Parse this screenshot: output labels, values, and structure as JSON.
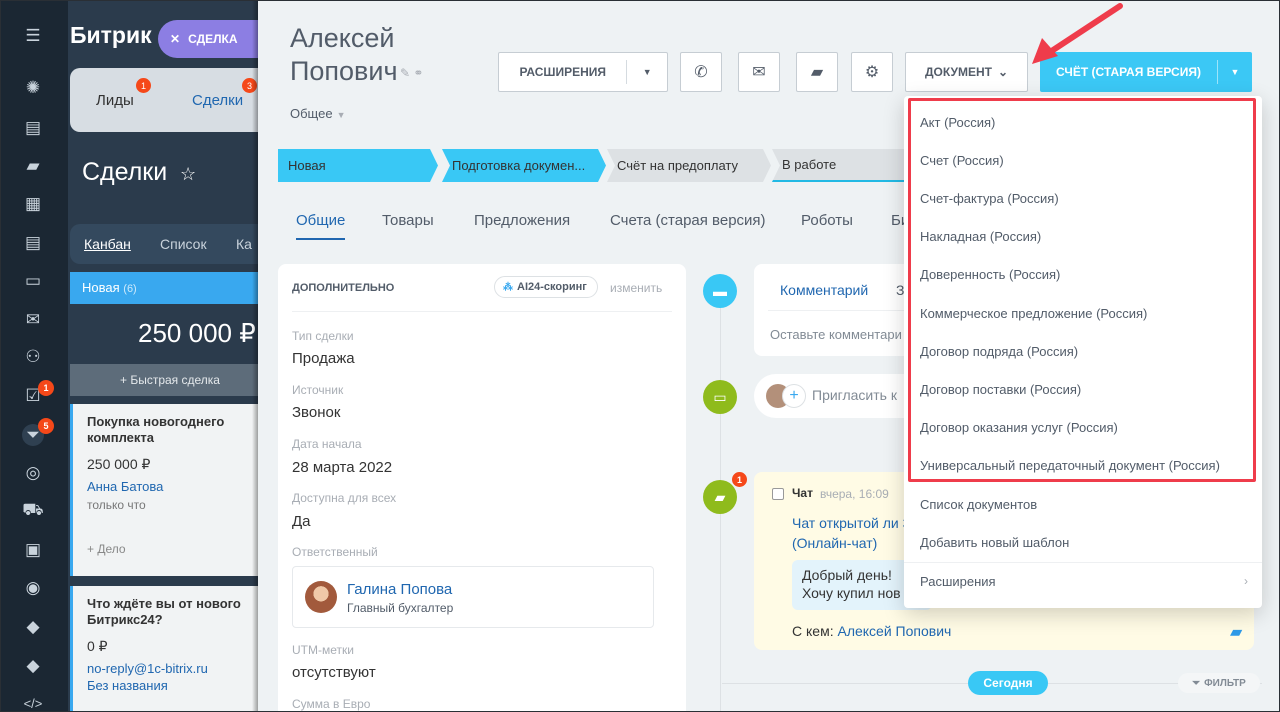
{
  "rail": {
    "badges": [
      "1",
      "5"
    ]
  },
  "background": {
    "logo": "Битрик",
    "close_chip": "СДЕЛКА",
    "tabs": [
      {
        "label": "Лиды",
        "badge": "1"
      },
      {
        "label": "Сделки",
        "badge": "3"
      }
    ],
    "title": "Сделки",
    "views": [
      "Канбан",
      "Список",
      "Ка"
    ],
    "stage": {
      "name": "Новая",
      "count": "(6)"
    },
    "stage_sum": "250 000 ₽",
    "quick_deal": "+ Быстрая сделка",
    "cards": [
      {
        "title": "Покупка новогоднего комплекта",
        "sum": "250 000 ₽",
        "contact": "Анна Батова",
        "time": "только что",
        "action": "+ Дело"
      },
      {
        "title": "Что ждёте вы от нового Битрикс24?",
        "sum": "0 ₽",
        "contact": "no-reply@1c-bitrix.ru",
        "time": "Без названия"
      }
    ]
  },
  "deal": {
    "name": "Алексей Попович",
    "category": "Общее",
    "toolbar": {
      "extensions": "РАСШИРЕНИЯ",
      "document": "ДОКУМЕНТ",
      "invoice": "СЧЁТ (СТАРАЯ ВЕРСИЯ)"
    },
    "stages": [
      "Новая",
      "Подготовка докумен...",
      "Счёт на предоплату",
      "В работе"
    ],
    "tabs": [
      "Общие",
      "Товары",
      "Предложения",
      "Счета (старая версия)",
      "Роботы",
      "Би"
    ],
    "panel": {
      "heading": "ДОПОЛНИТЕЛЬНО",
      "ai_chip": "AI24-скоринг",
      "edit": "изменить",
      "fields": [
        {
          "label": "Тип сделки",
          "value": "Продажа"
        },
        {
          "label": "Источник",
          "value": "Звонок"
        },
        {
          "label": "Дата начала",
          "value": "28 марта 2022"
        },
        {
          "label": "Доступна для всех",
          "value": "Да"
        }
      ],
      "responsible_label": "Ответственный",
      "responsible": {
        "name": "Галина Попова",
        "position": "Главный бухгалтер"
      },
      "utm_label": "UTM-метки",
      "utm_value": "отсутствуют",
      "euro_label": "Сумма в Евро"
    },
    "timeline": {
      "comment_tab": "Комментарий",
      "comment_tab2": "З",
      "comment_placeholder": "Оставьте комментари",
      "invite_text": "Пригласить к",
      "chat_badge": "1",
      "chat": {
        "title": "Чат",
        "time": "вчера, 16:09",
        "link": "Чат открытой ли 3\" (Онлайн-чат)",
        "bubble": "Добрый день! Хочу купил нов",
        "from_label": "С кем:",
        "from_name": "Алексей Попович"
      },
      "today": "Сегодня",
      "filter": "ФИЛЬТР"
    },
    "document_menu": {
      "templates": [
        "Акт (Россия)",
        "Счет (Россия)",
        "Счет-фактура (Россия)",
        "Накладная (Россия)",
        "Доверенность (Россия)",
        "Коммерческое предложение (Россия)",
        "Договор подряда (Россия)",
        "Договор поставки (Россия)",
        "Договор оказания услуг (Россия)",
        "Универсальный передаточный документ (Россия)"
      ],
      "actions": [
        "Список документов",
        "Добавить новый шаблон",
        "Расширения"
      ]
    }
  },
  "colors": {
    "accent": "#3bc8f5",
    "highlight": "#ef3c4b",
    "link": "#2067b0"
  }
}
